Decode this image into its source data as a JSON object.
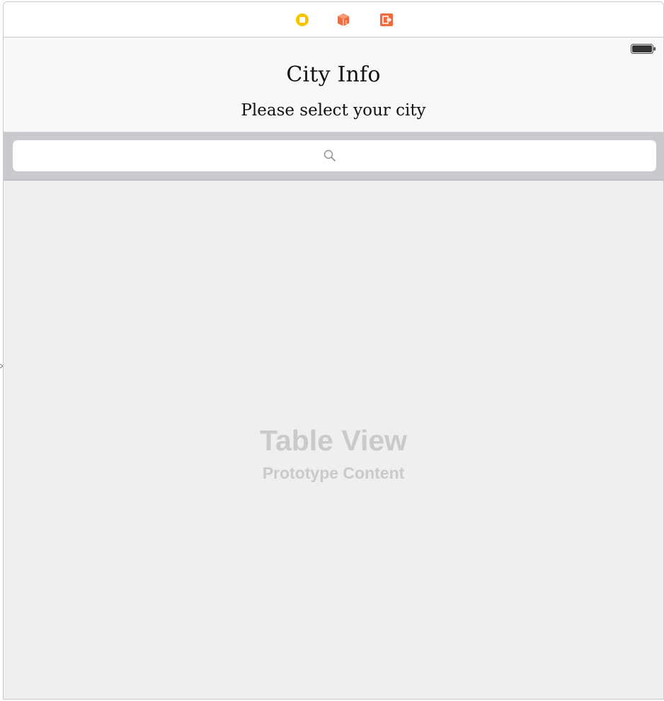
{
  "scene_dock": {
    "icons": [
      "view-controller-icon",
      "first-responder-icon",
      "exit-icon"
    ],
    "colors": {
      "view_controller": "#f5c400",
      "first_responder": "#f26a3d",
      "exit": "#f26a3d"
    }
  },
  "navigation": {
    "title": "City Info",
    "subtitle": "Please select your city"
  },
  "search": {
    "placeholder": "",
    "value": "",
    "icon": "search-icon"
  },
  "table_view": {
    "title": "Table View",
    "subtitle": "Prototype Content"
  },
  "status_bar": {
    "icons": [
      "battery-icon"
    ]
  }
}
